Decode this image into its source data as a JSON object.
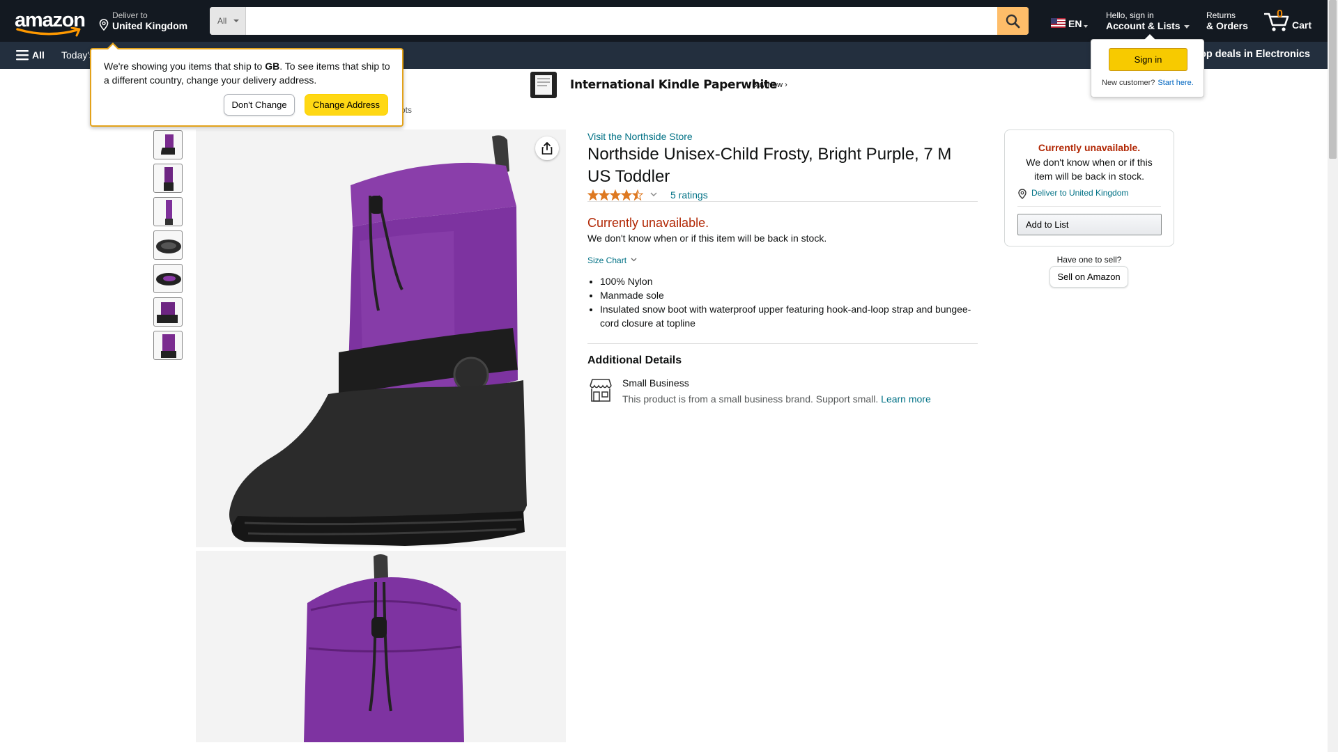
{
  "header": {
    "logo_text": "amazon",
    "deliver_line1": "Deliver to",
    "deliver_line2": "United Kingdom",
    "search": {
      "category": "All",
      "value": "",
      "placeholder": ""
    },
    "language": "EN",
    "account_line1": "Hello, sign in",
    "account_line2": "Account & Lists",
    "returns_line1": "Returns",
    "returns_line2": "& Orders",
    "cart_count": "0",
    "cart_label": "Cart",
    "accent_color": "#febd69",
    "nav_bg": "#131921",
    "subnav_bg": "#232f3e"
  },
  "subnav": {
    "all_label": "All",
    "today_label": "Today's",
    "right_label": "op deals in Electronics"
  },
  "promo": {
    "title": "International Kindle Paperwhite",
    "buy_now": "Buy Now ›"
  },
  "location_popover": {
    "msg_part1": "We're showing you items that ship to ",
    "msg_country": "GB",
    "msg_part2": ". To see items that ship to a different country, change your delivery address.",
    "dont_change": "Don't Change",
    "change_address": "Change Address",
    "breadcrumb_tail": "ots"
  },
  "signin_popover": {
    "sign_in": "Sign in",
    "new_customer": "New customer?",
    "start_here": "Start here."
  },
  "gallery": {
    "thumbnail_count": 7,
    "share_icon": "share-icon"
  },
  "product": {
    "store_link": "Visit the Northside Store",
    "title": "Northside Unisex-Child Frosty, Bright Purple, 7 M US Toddler",
    "rating_stars": 4.5,
    "ratings_text": "5 ratings",
    "unavailable": "Currently unavailable.",
    "unavailable_sub": "We don't know when or if this item will be back in stock.",
    "size_chart": "Size Chart",
    "bullets": [
      "100% Nylon",
      "Manmade sole",
      "Insulated snow boot with waterproof upper featuring hook-and-loop strap and bungee-cord closure at topline"
    ],
    "additional_title": "Additional Details",
    "small_business_title": "Small Business",
    "small_business_desc": "This product is from a small business brand. Support small.",
    "learn_more": "Learn more",
    "price_color": "#B12704",
    "link_color": "#007185"
  },
  "buybox": {
    "unavailable": "Currently unavailable.",
    "sub": "We don't know when or if this item will be back in stock.",
    "deliver": "Deliver to United Kingdom",
    "add_to_list": "Add to List",
    "have_one": "Have one to sell?",
    "sell": "Sell on Amazon"
  }
}
